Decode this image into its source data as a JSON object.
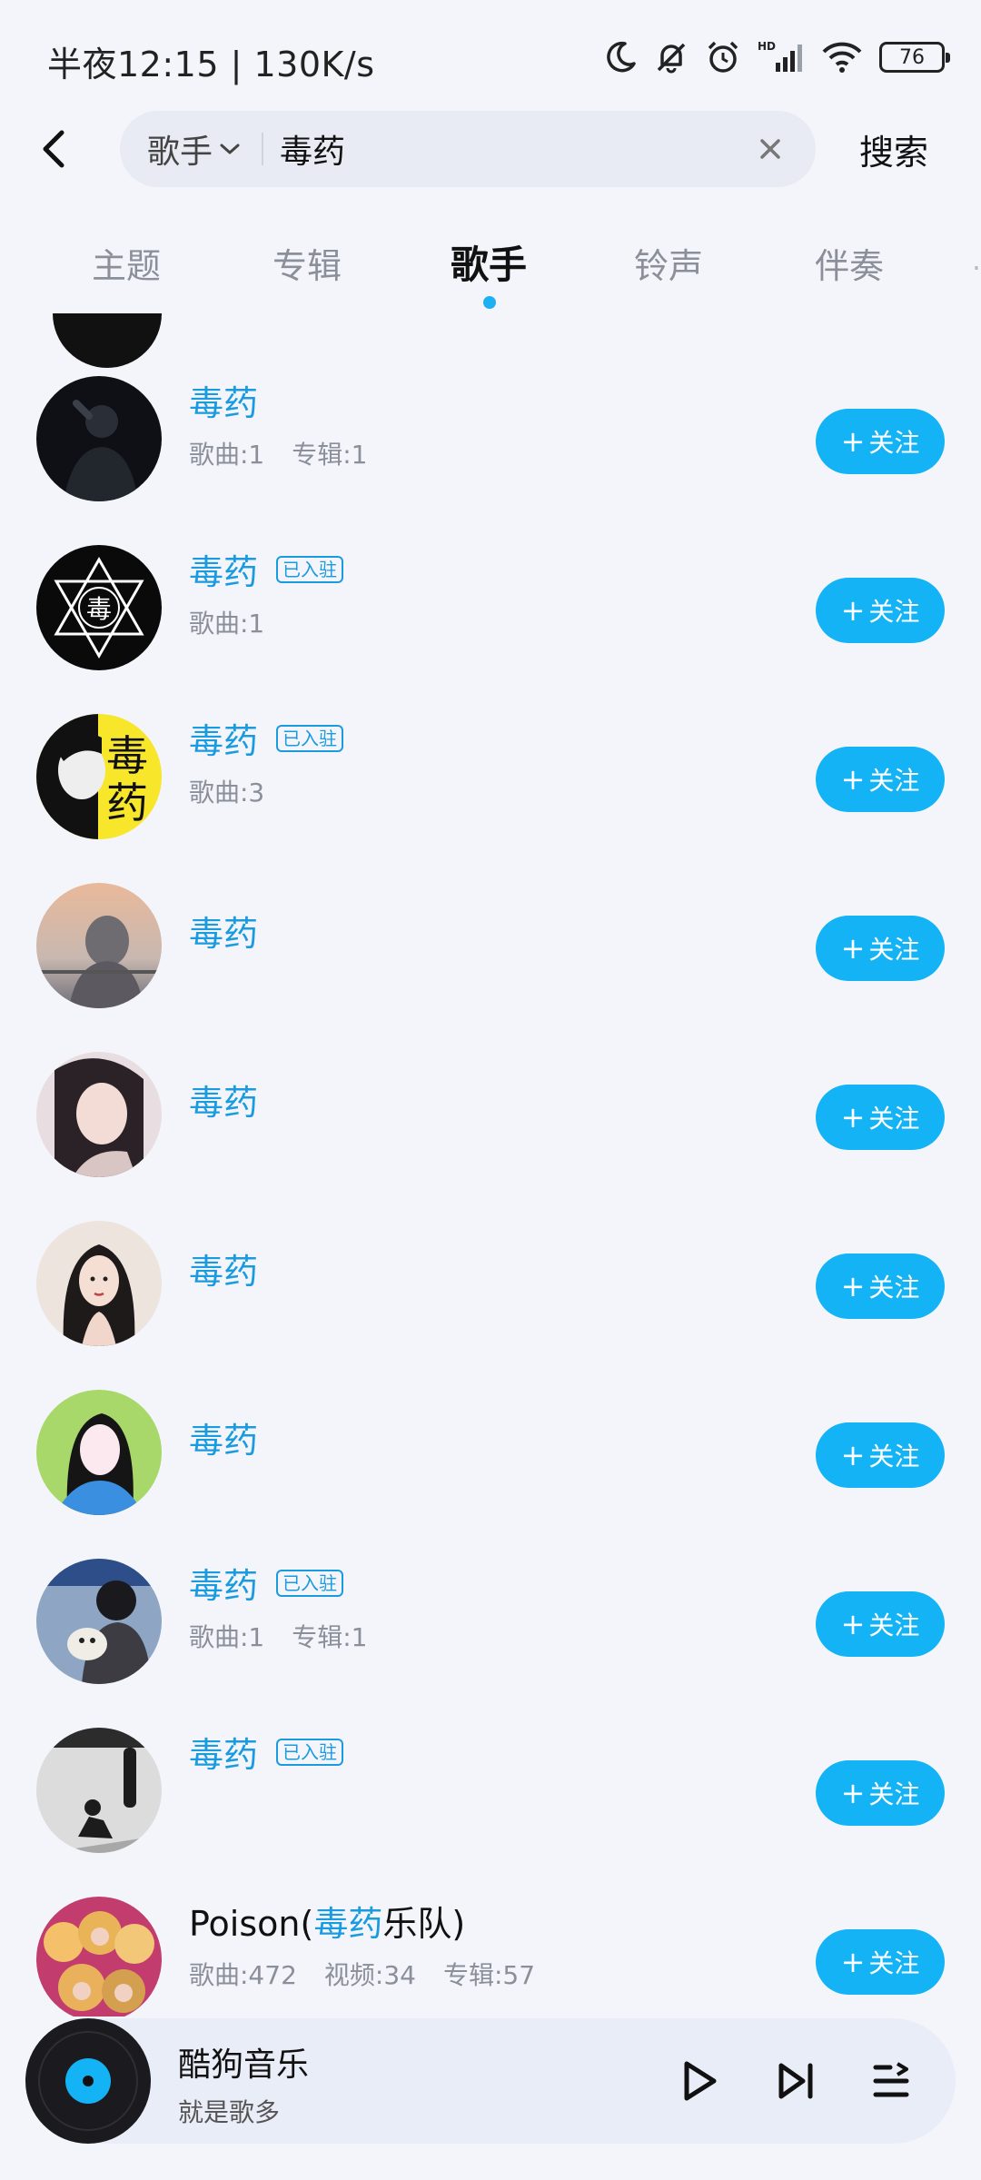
{
  "status": {
    "time": "半夜12:15 | 130K/s",
    "battery": "76",
    "icons": [
      "moon-icon",
      "bell-off-icon",
      "alarm-icon",
      "hd-signal-icon",
      "wifi-icon",
      "battery-icon"
    ]
  },
  "search": {
    "type_label": "歌手",
    "query": "毒药",
    "submit_label": "搜索"
  },
  "tabs": [
    {
      "label": "主题",
      "active": false
    },
    {
      "label": "专辑",
      "active": false
    },
    {
      "label": "歌手",
      "active": true
    },
    {
      "label": "铃声",
      "active": false
    },
    {
      "label": "伴奏",
      "active": false
    }
  ],
  "verified_label": "已入驻",
  "follow_label": "关注",
  "artists": [
    {
      "name": "毒药",
      "verified": false,
      "stats": [
        "歌曲:1",
        "专辑:1"
      ]
    },
    {
      "name": "毒药",
      "verified": true,
      "stats": [
        "歌曲:1"
      ]
    },
    {
      "name": "毒药",
      "verified": true,
      "stats": [
        "歌曲:3"
      ]
    },
    {
      "name": "毒药",
      "verified": false,
      "stats": []
    },
    {
      "name": "毒药",
      "verified": false,
      "stats": []
    },
    {
      "name": "毒药",
      "verified": false,
      "stats": []
    },
    {
      "name": "毒药",
      "verified": false,
      "stats": []
    },
    {
      "name": "毒药",
      "verified": true,
      "stats": [
        "歌曲:1",
        "专辑:1"
      ]
    },
    {
      "name": "毒药",
      "verified": true,
      "stats": []
    },
    {
      "name_pre": "Poison(",
      "name_hl": "毒药",
      "name_post": "乐队)",
      "verified": false,
      "stats": [
        "歌曲:472",
        "视频:34",
        "专辑:57"
      ]
    }
  ],
  "player": {
    "title": "酷狗音乐",
    "subtitle": "就是歌多"
  },
  "colors": {
    "accent": "#14b3f5",
    "highlight_text": "#1a9be0",
    "background": "#f3f5fa"
  }
}
